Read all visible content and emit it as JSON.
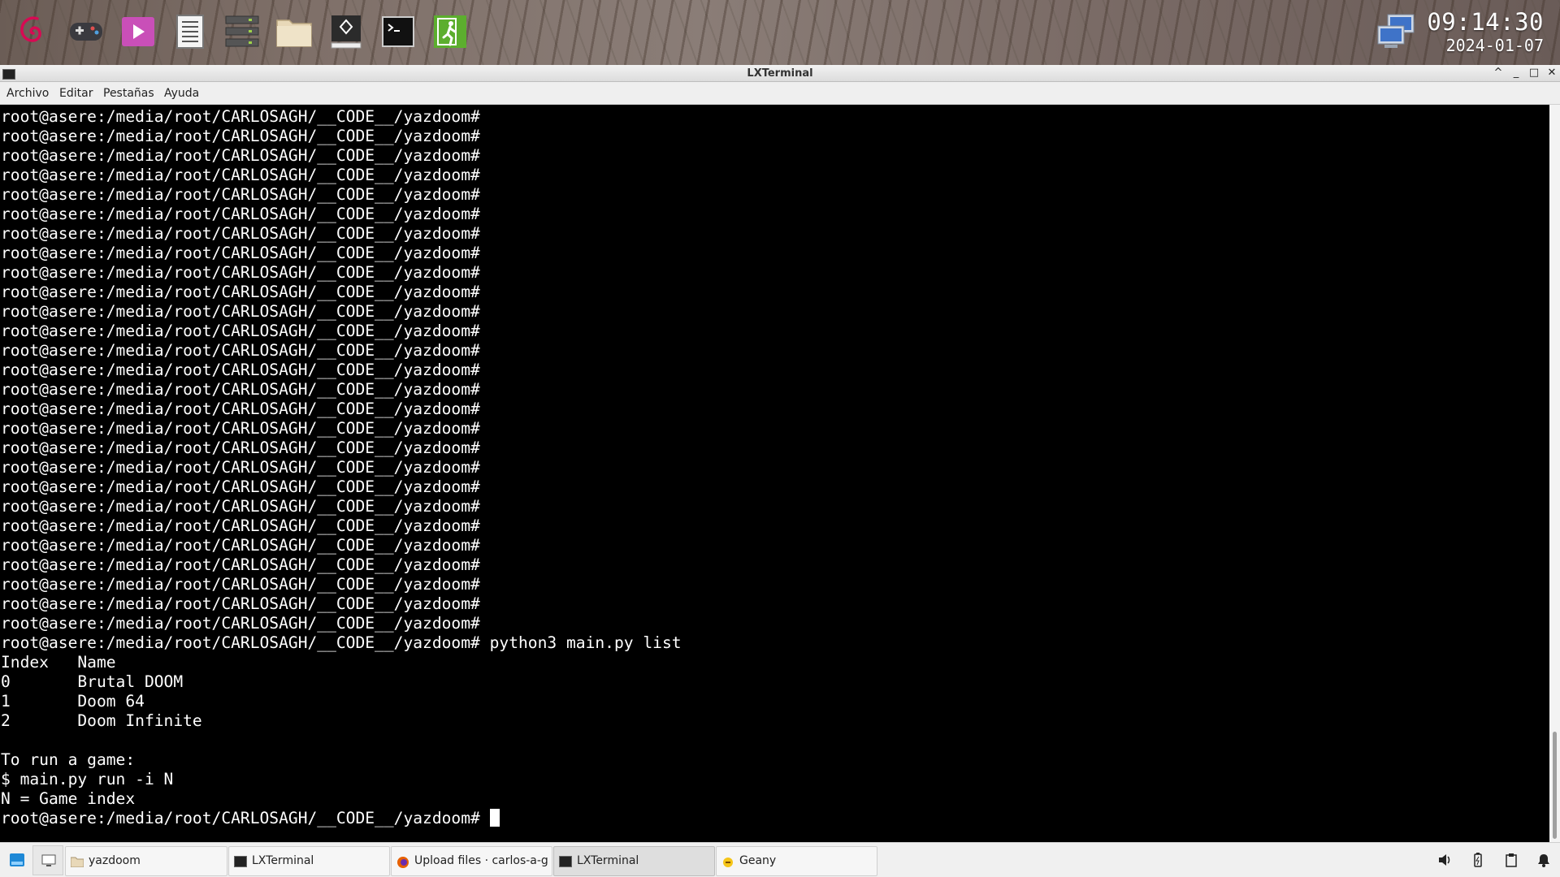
{
  "top_panel": {
    "launchers": [
      {
        "name": "debian-menu-icon"
      },
      {
        "name": "gamepad-icon"
      },
      {
        "name": "media-player-icon"
      },
      {
        "name": "text-editor-icon"
      },
      {
        "name": "task-manager-icon"
      },
      {
        "name": "file-manager-icon"
      },
      {
        "name": "geany-ide-icon"
      },
      {
        "name": "terminal-icon"
      },
      {
        "name": "logout-icon"
      }
    ],
    "network_icon": "network-computer-icon",
    "clock": {
      "time": "09:14:30",
      "date": "2024-01-07"
    }
  },
  "window": {
    "title": "LXTerminal",
    "controls": [
      "^",
      "_",
      "□",
      "✕"
    ]
  },
  "menu": {
    "items": [
      "Archivo",
      "Editar",
      "Pestañas",
      "Ayuda"
    ]
  },
  "terminal": {
    "lines": [
      "root@asere:/media/root/CARLOSAGH/__CODE__/yazdoom#",
      "root@asere:/media/root/CARLOSAGH/__CODE__/yazdoom#",
      "root@asere:/media/root/CARLOSAGH/__CODE__/yazdoom#",
      "root@asere:/media/root/CARLOSAGH/__CODE__/yazdoom#",
      "root@asere:/media/root/CARLOSAGH/__CODE__/yazdoom#",
      "root@asere:/media/root/CARLOSAGH/__CODE__/yazdoom#",
      "root@asere:/media/root/CARLOSAGH/__CODE__/yazdoom#",
      "root@asere:/media/root/CARLOSAGH/__CODE__/yazdoom#",
      "root@asere:/media/root/CARLOSAGH/__CODE__/yazdoom#",
      "root@asere:/media/root/CARLOSAGH/__CODE__/yazdoom#",
      "root@asere:/media/root/CARLOSAGH/__CODE__/yazdoom#",
      "root@asere:/media/root/CARLOSAGH/__CODE__/yazdoom#",
      "root@asere:/media/root/CARLOSAGH/__CODE__/yazdoom#",
      "root@asere:/media/root/CARLOSAGH/__CODE__/yazdoom#",
      "root@asere:/media/root/CARLOSAGH/__CODE__/yazdoom#",
      "root@asere:/media/root/CARLOSAGH/__CODE__/yazdoom#",
      "root@asere:/media/root/CARLOSAGH/__CODE__/yazdoom#",
      "root@asere:/media/root/CARLOSAGH/__CODE__/yazdoom#",
      "root@asere:/media/root/CARLOSAGH/__CODE__/yazdoom#",
      "root@asere:/media/root/CARLOSAGH/__CODE__/yazdoom#",
      "root@asere:/media/root/CARLOSAGH/__CODE__/yazdoom#",
      "root@asere:/media/root/CARLOSAGH/__CODE__/yazdoom#",
      "root@asere:/media/root/CARLOSAGH/__CODE__/yazdoom#",
      "root@asere:/media/root/CARLOSAGH/__CODE__/yazdoom#",
      "root@asere:/media/root/CARLOSAGH/__CODE__/yazdoom#",
      "root@asere:/media/root/CARLOSAGH/__CODE__/yazdoom#",
      "root@asere:/media/root/CARLOSAGH/__CODE__/yazdoom#",
      "root@asere:/media/root/CARLOSAGH/__CODE__/yazdoom# python3 main.py list",
      "Index   Name",
      "0       Brutal DOOM",
      "1       Doom 64",
      "2       Doom Infinite",
      "",
      "To run a game:",
      "$ main.py run -i N",
      "N = Game index"
    ],
    "prompt": "root@asere:/media/root/CARLOSAGH/__CODE__/yazdoom# "
  },
  "taskbar": {
    "start_icon": "start-menu-icon",
    "show_desktop_icon": "show-desktop-icon",
    "tasks": [
      {
        "label": "yazdoom",
        "icon": "folder-icon"
      },
      {
        "label": "LXTerminal",
        "icon": "terminal-icon"
      },
      {
        "label": "Upload files · carlos-a-g...",
        "icon": "firefox-icon"
      },
      {
        "label": "LXTerminal",
        "icon": "terminal-icon"
      },
      {
        "label": "Geany",
        "icon": "geany-icon"
      }
    ],
    "tray": [
      "volume-icon",
      "battery-icon",
      "clipboard-icon",
      "notification-bell-icon"
    ]
  },
  "colors": {
    "terminal_bg": "#000000",
    "terminal_fg": "#ffffff",
    "media_player": "#c94fb8",
    "logout": "#5cae2e",
    "debian_red": "#d70a53"
  }
}
